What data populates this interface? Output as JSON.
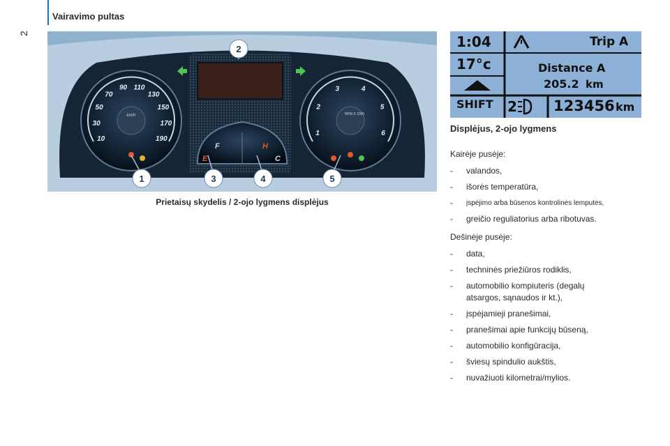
{
  "header": {
    "title": "Vairavimo pultas",
    "page_number": "2"
  },
  "figure": {
    "caption": "Prietaisų skydelis / 2-ojo lygmens displėjus",
    "callouts": [
      "1",
      "2",
      "3",
      "4",
      "5"
    ],
    "speedometer": {
      "ticks": [
        "10",
        "30",
        "50",
        "70",
        "90",
        "110",
        "130",
        "150",
        "170",
        "190"
      ],
      "unit": "km/h"
    },
    "tachometer": {
      "ticks": [
        "1",
        "2",
        "3",
        "4",
        "5",
        "6"
      ],
      "unit": "RPM X 1000"
    },
    "fuel_gauge": {
      "full": "F",
      "empty": "E"
    },
    "temp_gauge": {
      "hot": "H",
      "cold": "C"
    }
  },
  "lcd": {
    "time": "1:04",
    "temperature": "17°c",
    "shift": "SHIFT",
    "gear": "2",
    "trip_label": "Trip A",
    "distance_label": "Distance A",
    "distance_value": "205.2",
    "distance_unit": "km",
    "odometer": "123456",
    "odometer_unit": "km"
  },
  "content": {
    "section_title": "Displėjus, 2-ojo lygmens",
    "left_title": "Kairėje pusėje:",
    "left_items": [
      "valandos,",
      "išorės temperatūra,",
      "įspėjimo arba būsenos kontrolinės lemputės,",
      "greičio reguliatorius arba ribotuvas."
    ],
    "right_title": "Dešinėje pusėje:",
    "right_items": [
      "data,",
      "techninės priežiūros rodiklis,",
      "automobilio kompiuteris (degalų atsargos, sąnaudos ir kt.),",
      "įspėjamieji pranešimai,",
      "pranešimai apie funkcijų būseną,",
      "automobilio konfigūracija,",
      "šviesų spindulio aukštis,",
      "nuvažiuoti kilometrai/mylios."
    ]
  }
}
